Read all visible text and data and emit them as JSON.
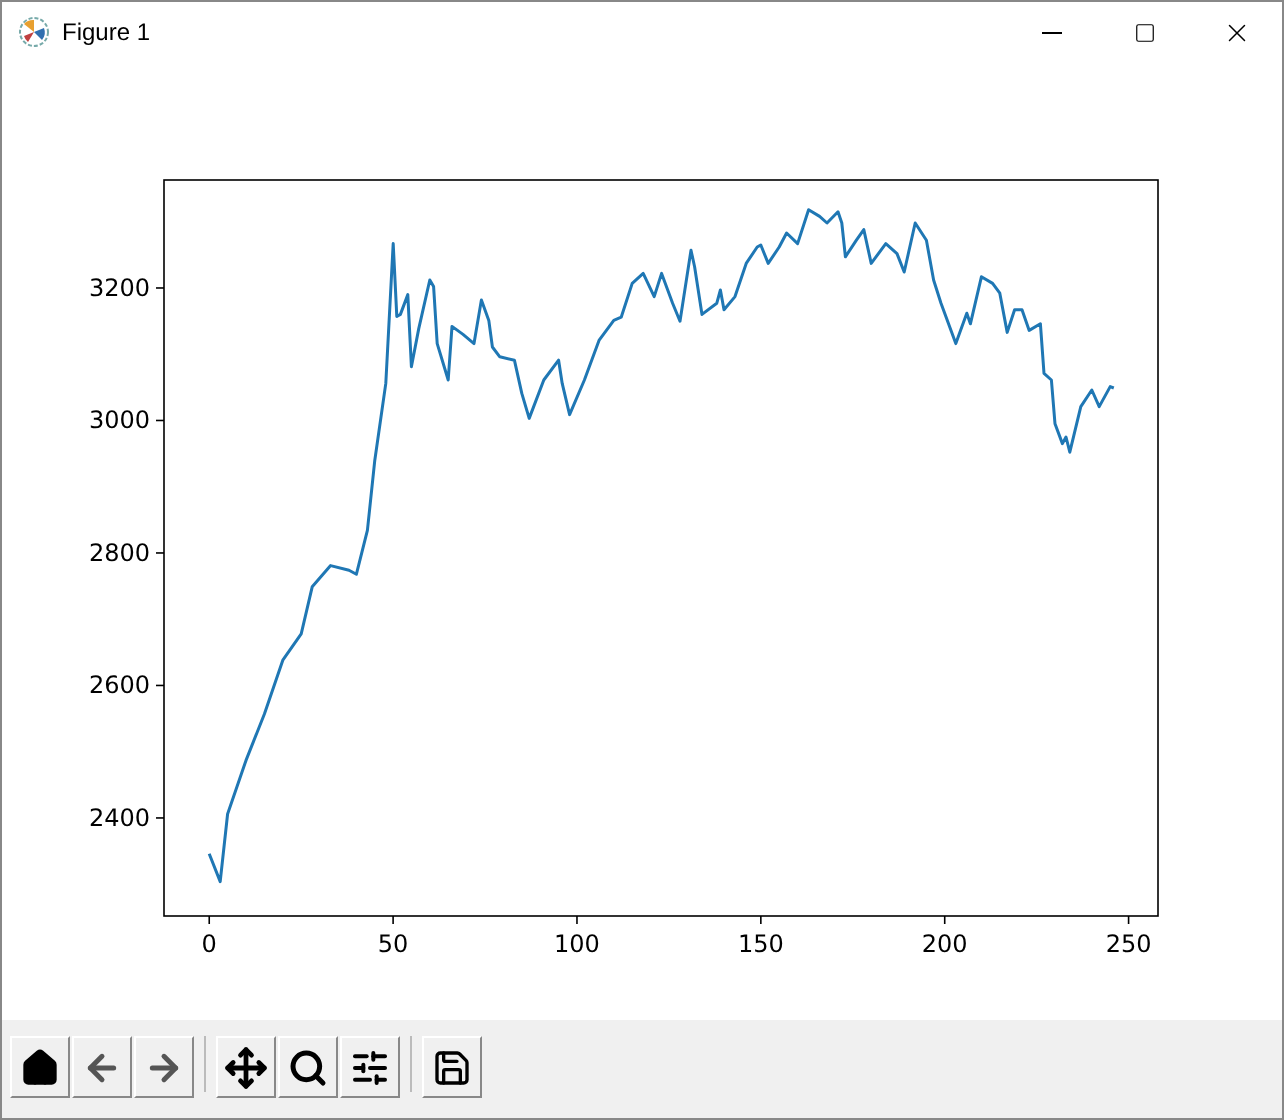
{
  "window": {
    "title": "Figure 1"
  },
  "figure": {
    "chart_data": {
      "type": "line",
      "xlim": [
        -12.3,
        258
      ],
      "ylim": [
        2252,
        3363
      ],
      "xticks": [
        0,
        50,
        100,
        150,
        200,
        250
      ],
      "yticks": [
        2400,
        2600,
        2800,
        3000,
        3200
      ],
      "x": [
        0,
        3,
        5,
        10,
        15,
        20,
        25,
        28,
        33,
        38,
        40,
        43,
        45,
        48,
        50,
        51,
        52,
        54,
        55,
        57,
        60,
        61,
        62,
        65,
        66,
        69,
        72,
        74,
        76,
        77,
        79,
        83,
        85,
        87,
        91,
        95,
        96,
        98,
        102,
        106,
        110,
        112,
        115,
        118,
        121,
        123,
        126,
        128,
        131,
        132,
        134,
        138,
        139,
        140,
        143,
        146,
        149,
        150,
        152,
        155,
        157,
        160,
        163,
        166,
        168,
        171,
        172,
        173,
        176,
        178,
        180,
        184,
        187,
        189,
        192,
        195,
        197,
        199,
        203,
        206,
        207,
        210,
        213,
        215,
        217,
        219,
        221,
        223,
        226,
        227,
        229,
        230,
        232,
        233,
        234,
        237,
        240,
        242,
        245,
        246
      ],
      "series": [
        {
          "color": "#1f77b4",
          "values": [
            2346,
            2304,
            2406,
            2487,
            2557,
            2638,
            2678,
            2749,
            2781,
            2774,
            2768,
            2834,
            2940,
            3056,
            3267,
            3157,
            3160,
            3190,
            3081,
            3139,
            3212,
            3202,
            3116,
            3061,
            3142,
            3130,
            3116,
            3182,
            3151,
            3111,
            3096,
            3091,
            3041,
            3003,
            3061,
            3091,
            3056,
            3009,
            3061,
            3121,
            3151,
            3156,
            3207,
            3222,
            3187,
            3222,
            3177,
            3150,
            3257,
            3232,
            3160,
            3177,
            3197,
            3167,
            3187,
            3237,
            3262,
            3265,
            3237,
            3262,
            3283,
            3267,
            3318,
            3308,
            3298,
            3315,
            3298,
            3247,
            3272,
            3288,
            3237,
            3267,
            3252,
            3224,
            3298,
            3272,
            3212,
            3177,
            3116,
            3162,
            3146,
            3217,
            3207,
            3192,
            3133,
            3167,
            3167,
            3136,
            3146,
            3071,
            3061,
            2995,
            2965,
            2975,
            2952,
            3021,
            3046,
            3021,
            3051,
            3049
          ]
        }
      ]
    }
  }
}
